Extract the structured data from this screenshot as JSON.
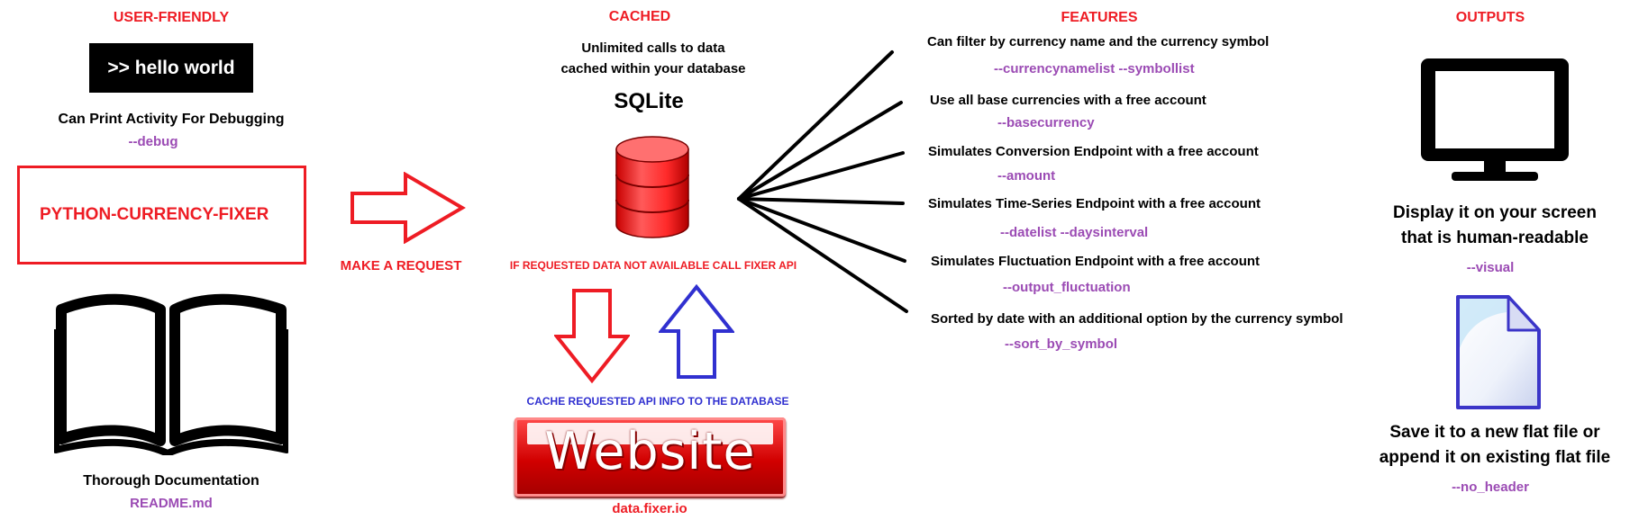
{
  "user_friendly": {
    "header": "USER-FRIENDLY",
    "terminal_text": ">> hello world",
    "debug_desc": "Can Print Activity For Debugging",
    "debug_flag": "--debug",
    "project_name": "PYTHON-CURRENCY-FIXER",
    "docs_title": "Thorough Documentation",
    "docs_file": "README.md"
  },
  "request_label": "MAKE A REQUEST",
  "cached": {
    "header": "CACHED",
    "line1": "Unlimited calls to data",
    "line2": "cached within your database",
    "db_name": "SQLite",
    "fallback_label": "IF REQUESTED DATA NOT AVAILABLE CALL FIXER API",
    "cache_label": "CACHE REQUESTED API INFO TO  THE  DATABASE",
    "website_text": "Website",
    "website_url": "data.fixer.io"
  },
  "features": {
    "header": "FEATURES",
    "items": [
      {
        "desc": "Can filter by currency name and  the  currency symbol",
        "flag": "--currencynamelist --symbollist"
      },
      {
        "desc": "Use all base currencies with a free account",
        "flag": "--basecurrency"
      },
      {
        "desc": "Simulates Conversion Endpoint with a free account",
        "flag": "--amount"
      },
      {
        "desc": "Simulates Time-Series Endpoint with a free account",
        "flag": "--datelist --daysinterval"
      },
      {
        "desc": "Simulates Fluctuation Endpoint with a free account",
        "flag": "--output_fluctuation"
      },
      {
        "desc": "Sorted by date with an additional option by the currency symbol",
        "flag": "--sort_by_symbol"
      }
    ]
  },
  "outputs": {
    "header": "OUTPUTS",
    "screen_line1": "Display it on your screen",
    "screen_line2": "that is human-readable",
    "screen_flag": "--visual",
    "file_line1": "Save it to a new flat file or",
    "file_line2": "append it on existing flat file",
    "file_flag": "--no_header"
  },
  "colors": {
    "red": "#ee1c24",
    "purple": "#9b4bb4",
    "blue": "#3030d0",
    "black": "#000000"
  }
}
